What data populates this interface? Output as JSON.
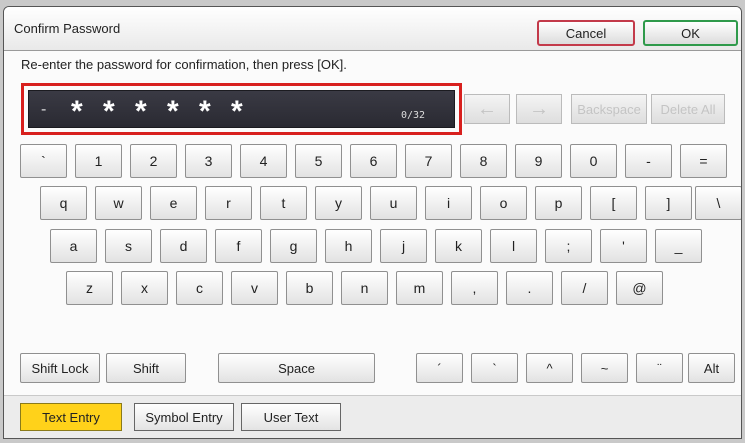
{
  "header": {
    "title": "Confirm Password",
    "cancel_label": "Cancel",
    "ok_label": "OK",
    "cancel_color": "#c33a4a",
    "ok_color": "#2f9a4b"
  },
  "instruction": "Re-enter the password for confirmation, then press [OK].",
  "password": {
    "prefix": "-",
    "masked_value": "******",
    "counter": "0/32"
  },
  "edit_buttons": {
    "left_arrow": "←",
    "right_arrow": "→",
    "backspace": "Backspace",
    "delete_all": "Delete All"
  },
  "keyboard": {
    "row1": [
      "`",
      "1",
      "2",
      "3",
      "4",
      "5",
      "6",
      "7",
      "8",
      "9",
      "0",
      "-",
      "="
    ],
    "row2": [
      "q",
      "w",
      "e",
      "r",
      "t",
      "y",
      "u",
      "i",
      "o",
      "p",
      "[",
      "]",
      "\\"
    ],
    "row3": [
      "a",
      "s",
      "d",
      "f",
      "g",
      "h",
      "j",
      "k",
      "l",
      ";",
      "'",
      "_"
    ],
    "row4": [
      "z",
      "x",
      "c",
      "v",
      "b",
      "n",
      "m",
      ",",
      ".",
      "/",
      "@"
    ]
  },
  "function_keys": {
    "shift_lock": "Shift Lock",
    "shift": "Shift",
    "space": "Space",
    "accents": [
      "´",
      "`",
      "^",
      "~",
      "¨"
    ],
    "alt": "Alt"
  },
  "tabs": [
    {
      "label": "Text Entry",
      "active": true
    },
    {
      "label": "Symbol Entry",
      "active": false
    },
    {
      "label": "User Text",
      "active": false
    }
  ],
  "colors": {
    "highlight_border": "#d8201e",
    "active_tab": "#ffd21a"
  }
}
